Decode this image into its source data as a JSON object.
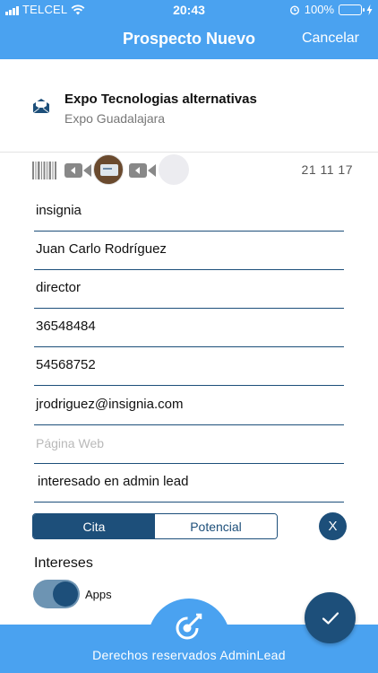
{
  "status_bar": {
    "carrier": "TELCEL",
    "time": "20:43",
    "battery": "100%"
  },
  "nav": {
    "title": "Prospecto Nuevo",
    "cancel_label": "Cancelar"
  },
  "event": {
    "title": "Expo Tecnologias alternativas",
    "subtitle": "Expo Guadalajara"
  },
  "media": {
    "date": "21 11 17"
  },
  "form": {
    "fields": [
      {
        "value": "insignia",
        "placeholder": ""
      },
      {
        "value": "Juan Carlo Rodríguez",
        "placeholder": ""
      },
      {
        "value": "director",
        "placeholder": ""
      },
      {
        "value": "36548484",
        "placeholder": ""
      },
      {
        "value": "54568752",
        "placeholder": ""
      },
      {
        "value": "jrodriguez@insignia.com",
        "placeholder": ""
      },
      {
        "value": "",
        "placeholder": "Página Web"
      },
      {
        "value": "interesado en admin lead",
        "placeholder": ""
      }
    ]
  },
  "segment": {
    "options": [
      "Cita",
      "Potencial"
    ],
    "selected": "Cita",
    "clear_label": "X"
  },
  "interests": {
    "heading": "Intereses",
    "items": [
      {
        "label": "Apps",
        "on": true
      }
    ]
  },
  "footer": {
    "text": "Derechos reservados AdminLead"
  },
  "colors": {
    "accent": "#4aa2f0",
    "primary": "#1d4f7a"
  }
}
